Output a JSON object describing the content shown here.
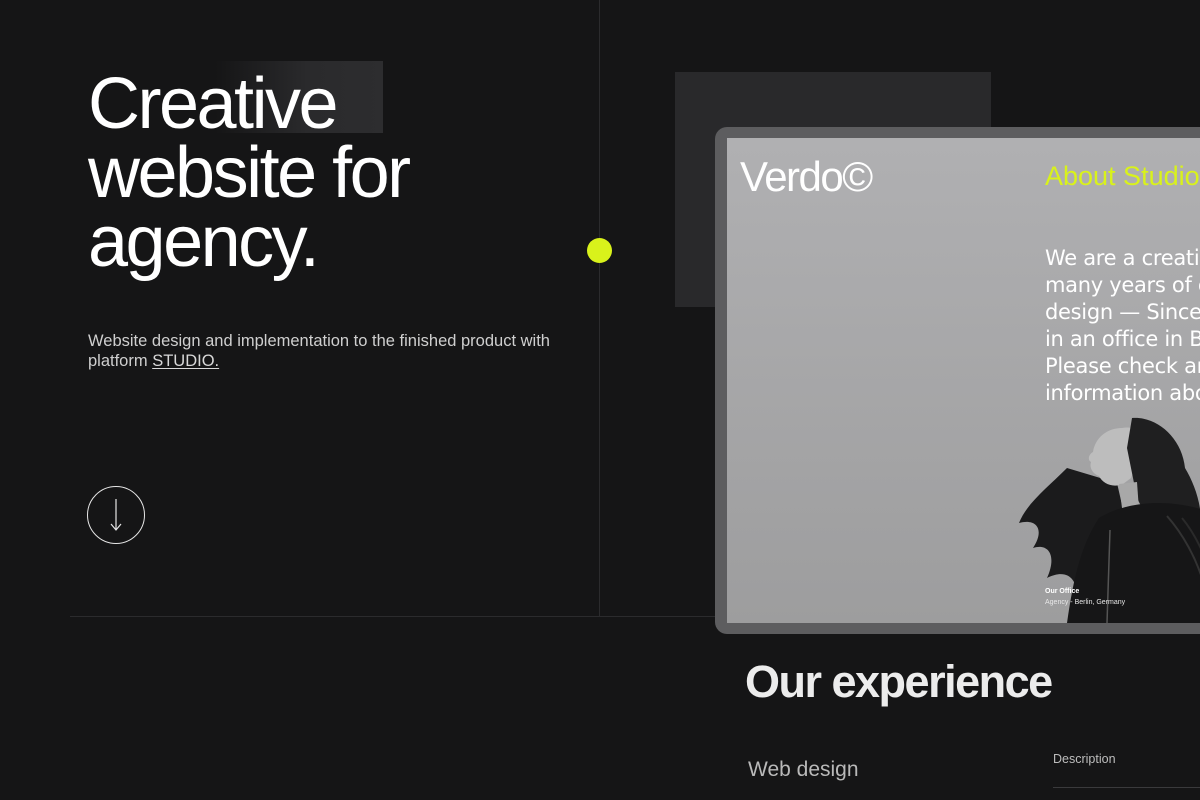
{
  "hero": {
    "title_lines": [
      "Creative",
      "website for",
      "agency."
    ],
    "subtitle_text": "Website design and implementation to the finished product with platform ",
    "subtitle_link": "STUDIO."
  },
  "scroll_button": {
    "icon": "arrow-down-icon"
  },
  "accent_color": "#d9f21b",
  "preview": {
    "logo": "Verdo©",
    "about_heading": "About Studio",
    "about_lines": [
      "We are a creativ",
      "many years of e",
      "design — Since",
      "in an office in B",
      "Please check ar",
      "information abo"
    ],
    "office_title": "Our Office",
    "office_location": "Agency - Berlin, Germany"
  },
  "experience": {
    "title": "Our experience",
    "item": "Web design",
    "description_label": "Description"
  }
}
